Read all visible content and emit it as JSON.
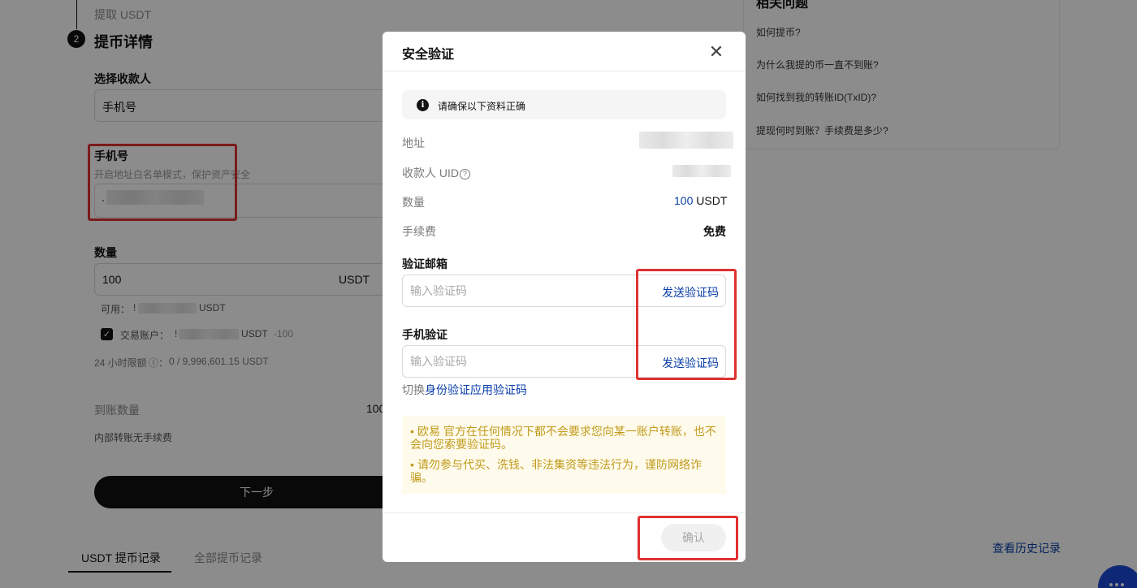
{
  "page": {
    "prev_step": "提取 USDT",
    "step_number": "2",
    "step_title": "提币详情",
    "recipient_label": "选择收款人",
    "recipient_value": "手机号",
    "phone_label": "手机号",
    "phone_hint": "开启地址白名单模式，保护资产安全",
    "phone_value_prefix": ".",
    "amount_label": "数量",
    "amount_value": "100",
    "amount_unit": "USDT",
    "available_label": "可用：",
    "available_prefix": "!",
    "available_unit": "USDT",
    "trading_account_label": "交易账户：",
    "trading_account_prefix": "!",
    "trading_account_unit": "USDT",
    "trading_account_delta": "-100",
    "limit_label": "24 小时限额",
    "limit_value": "0 / 9,996,601.15 USDT",
    "received_label": "到账数量",
    "received_value": "100",
    "internal_fee_note": "内部转账无手续费",
    "next_button": "下一步",
    "tabs": [
      "USDT 提币记录",
      "全部提币记录"
    ],
    "history_link": "查看历史记录",
    "faq": {
      "title": "相关问题",
      "items": [
        "如何提币?",
        "为什么我提的币一直不到账?",
        "如何找到我的转账ID(TxID)?",
        "提现何时到账？手续费是多少?"
      ]
    }
  },
  "modal": {
    "title": "安全验证",
    "notice": "请确保以下资料正确",
    "rows": {
      "address_label": "地址",
      "uid_label": "收款人 UID",
      "amount_label": "数量",
      "amount_value": "100",
      "amount_unit": "USDT",
      "fee_label": "手续费",
      "fee_value": "免费"
    },
    "email_label": "验证邮箱",
    "email_placeholder": "输入验证码",
    "email_send": "发送验证码",
    "phone_label": "手机验证",
    "phone_placeholder": "输入验证码",
    "phone_send": "发送验证码",
    "switch_prefix": "切换",
    "switch_link": "身份验证应用验证码",
    "warnings": [
      "欧易 官方在任何情况下都不会要求您向某一账户转账，也不会向您索要验证码。",
      "请勿参与代买、洗钱、非法集资等违法行为，谨防网络诈骗。"
    ],
    "confirm_button": "确认"
  },
  "colors": {
    "accent_blue": "#0a3ea8",
    "highlight_red": "#e03131",
    "warning_text": "#c19a1a",
    "warning_bg": "#fffbec"
  }
}
